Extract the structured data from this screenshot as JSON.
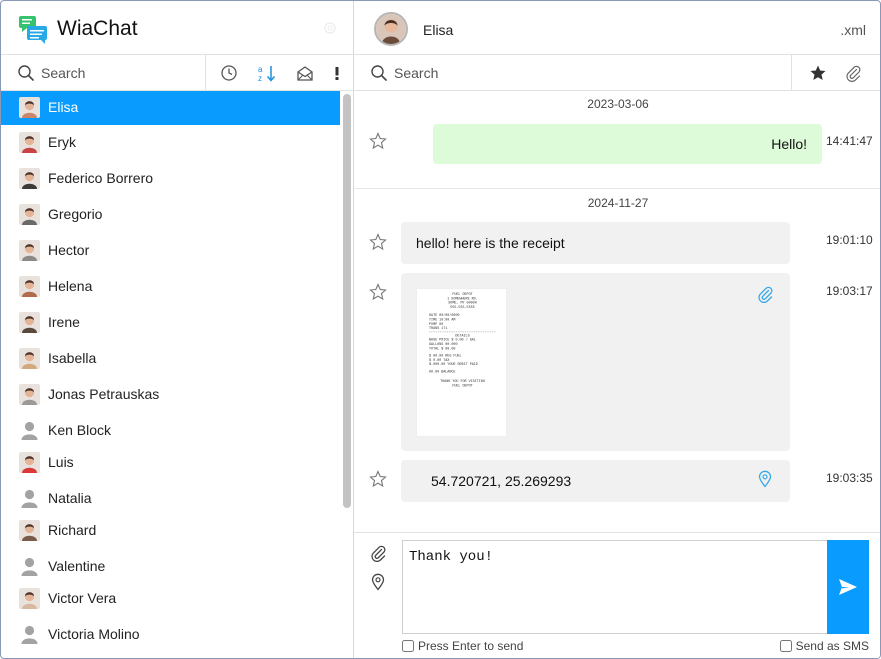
{
  "app": {
    "title": "WiaChat"
  },
  "left_search": {
    "placeholder": "Search"
  },
  "contacts": [
    {
      "name": "Elisa",
      "active": true,
      "avatar_color": "#c9876d"
    },
    {
      "name": "Eryk",
      "active": false,
      "avatar_color": "#c74444"
    },
    {
      "name": "Federico Borrero",
      "active": false,
      "avatar_color": "#3a3a3a"
    },
    {
      "name": "Gregorio",
      "active": false,
      "avatar_color": "#6a6a6a"
    },
    {
      "name": "Hector",
      "active": false,
      "avatar_color": "#8a8a8a"
    },
    {
      "name": "Helena",
      "active": false,
      "avatar_color": "#b06a4c"
    },
    {
      "name": "Irene",
      "active": false,
      "avatar_color": "#5b4a3c"
    },
    {
      "name": "Isabella",
      "active": false,
      "avatar_color": "#d2a97c"
    },
    {
      "name": "Jonas Petrauskas",
      "active": false,
      "avatar_color": "#9a9a9a"
    },
    {
      "name": "Ken Block",
      "active": false,
      "avatar_color": ""
    },
    {
      "name": "Luis",
      "active": false,
      "avatar_color": "#d83a3a"
    },
    {
      "name": "Natalia",
      "active": false,
      "avatar_color": ""
    },
    {
      "name": "Richard",
      "active": false,
      "avatar_color": "#7a5a4a"
    },
    {
      "name": "Valentine",
      "active": false,
      "avatar_color": ""
    },
    {
      "name": "Victor Vera",
      "active": false,
      "avatar_color": "#d8b9a0"
    },
    {
      "name": "Victoria Molino",
      "active": false,
      "avatar_color": ""
    }
  ],
  "chat": {
    "contact_name": "Elisa",
    "export_label": ".xml",
    "search_placeholder": "Search",
    "days": [
      {
        "date": "2023-03-06"
      },
      {
        "date": "2024-11-27"
      }
    ],
    "messages": [
      {
        "kind": "text",
        "direction": "outgoing",
        "text": "Hello!",
        "time": "14:41:47"
      },
      {
        "kind": "text",
        "direction": "incoming",
        "text": "hello! here is the receipt",
        "time": "19:01:10"
      },
      {
        "kind": "image",
        "direction": "incoming",
        "time": "19:03:17"
      },
      {
        "kind": "location",
        "direction": "incoming",
        "text": "54.720721, 25.269293",
        "time": "19:03:35"
      }
    ]
  },
  "receipt": {
    "header": [
      "FUEL DEPOT",
      "1 SOMEWHERE RD.",
      "SOME, MY 00000",
      "555-555-5555"
    ],
    "rows": [
      "DATE        00/00/0000",
      "TIME        10:00 AM",
      "PUMP        00",
      "TRANS       171"
    ],
    "details_title": "DETAILS",
    "details": [
      "BASE PRICE  $ 0.00 / GAL",
      "GALLONS     00.000",
      "TOTAL       $ 00.00"
    ],
    "notes": [
      "$ 00.00 REG FUEL",
      "$ 0.00 TAX",
      "$-000.00 YOUR DEBIT PAID",
      "00.00 BALANCE"
    ],
    "footer": [
      "THANK YOU FOR VISITING",
      "FUEL DEPOT"
    ]
  },
  "composer": {
    "text": "Thank you!",
    "press_enter_label": "Press Enter to send",
    "sms_label": "Send as SMS"
  },
  "colors": {
    "accent": "#0a9bff",
    "outgoing_bubble": "#ddfbd8",
    "incoming_bubble": "#f1f1f1"
  }
}
